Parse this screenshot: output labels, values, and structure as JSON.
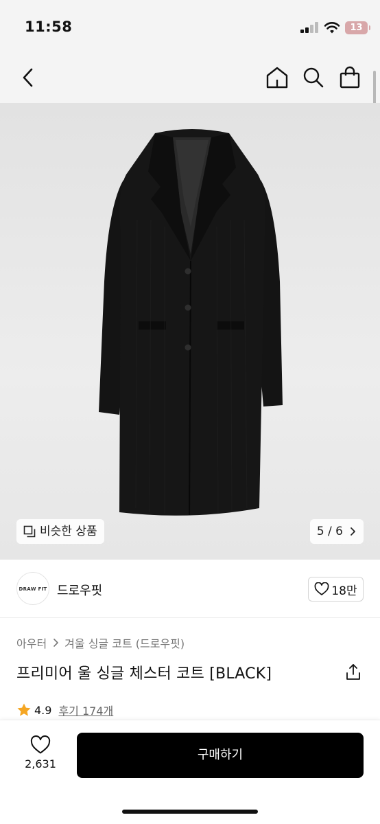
{
  "status_bar": {
    "time": "11:58",
    "battery": "13",
    "icons": [
      "signal-icon",
      "wifi-icon",
      "battery-icon"
    ]
  },
  "nav": {
    "icons": [
      "back-icon",
      "home-icon",
      "search-icon",
      "shopping-bag-icon"
    ]
  },
  "gallery": {
    "similar_label": "비슷한 상품",
    "page_indicator": "5 / 6",
    "icons": [
      "similar-items-icon",
      "chevron-right-icon"
    ]
  },
  "brand": {
    "logo_text": "DRAW FIT",
    "name": "드로우핏",
    "like_count": "18만"
  },
  "breadcrumb": {
    "category": "아우터",
    "subcategory": "겨울 싱글 코트 (드로우핏)"
  },
  "product": {
    "title": "프리미어 울 싱글 체스터 코트 [BLACK]"
  },
  "rating": {
    "score": "4.9",
    "reviews_label": "후기 174개",
    "star_color": "#f5a623"
  },
  "bottom_bar": {
    "wish_count": "2,631",
    "buy_label": "구매하기"
  },
  "colors": {
    "buy_button": "#000000",
    "battery_badge": "#d8a7a9"
  }
}
